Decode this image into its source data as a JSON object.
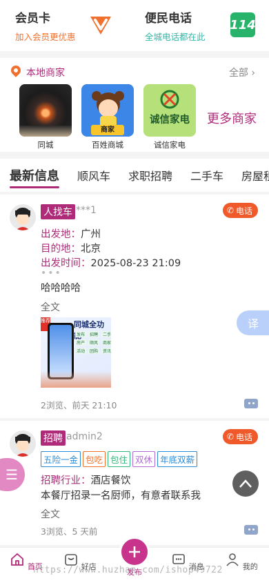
{
  "top_cards": [
    {
      "title": "会员卡",
      "subtitle": "加入会员更优惠",
      "subtitle_color": "#f0712d",
      "icon": "v-badge-icon"
    },
    {
      "title": "便民电话",
      "subtitle": "全城电话都在此",
      "subtitle_color": "#2fb8a8",
      "icon": "phone-114-icon",
      "icon_text": "114"
    }
  ],
  "local": {
    "title": "本地商家",
    "all_label": "全部",
    "merchants": [
      {
        "name": "同城",
        "thumb": "speaker-photo"
      },
      {
        "name": "百姓商城",
        "thumb": "cartoon-girl",
        "badge": "商家"
      },
      {
        "name": "诚信家电",
        "thumb": "chengxin-logo",
        "logo_text": "诚信家电"
      }
    ],
    "more_label": "更多商家"
  },
  "tabs": [
    "最新信息",
    "顺风车",
    "求职招聘",
    "二手车",
    "房屋租"
  ],
  "posts": [
    {
      "tag": "人找车",
      "author": "***1",
      "phone_label": "电话",
      "fields": [
        {
          "key": "出发地：",
          "value": "广州"
        },
        {
          "key": "目的地：",
          "value": "北京"
        },
        {
          "key": "出发时间：",
          "value": "2025-08-23 21:09"
        }
      ],
      "dots": "•••",
      "body": "哈哈哈哈",
      "fulltext_label": "全文",
      "image": {
        "corner": "推荐",
        "headline": "同城全功能",
        "items": [
          "发布",
          "招聘",
          "二手",
          "房产",
          "顺风",
          "商家",
          "活动",
          "团购",
          "资讯"
        ]
      },
      "meta": "2浏览、前天 21:10"
    },
    {
      "tag": "招聘",
      "author": "admin2",
      "phone_label": "电话",
      "chips": [
        {
          "text": "五险一金",
          "color": "#2a8bd6"
        },
        {
          "text": "包吃",
          "color": "#f0712d"
        },
        {
          "text": "包住",
          "color": "#2fb87a"
        },
        {
          "text": "双休",
          "color": "#b06ad6"
        },
        {
          "text": "年底双薪",
          "color": "#2a8bd6"
        }
      ],
      "field": {
        "key": "招聘行业：",
        "value": "酒店餐饮"
      },
      "body": "本餐厅招录一名厨师，有意者联系我",
      "fulltext_label": "全文",
      "meta": "3浏览、5 天前"
    }
  ],
  "floating": {
    "translate_label": "译",
    "menu_label": "☰"
  },
  "bottom_nav": [
    {
      "label": "首页",
      "icon": "home-icon",
      "active": true
    },
    {
      "label": "好店",
      "icon": "shop-icon"
    },
    {
      "label": "发布",
      "icon": "plus-icon",
      "publish": true
    },
    {
      "label": "消息",
      "icon": "message-icon"
    },
    {
      "label": "我的",
      "icon": "user-icon"
    }
  ],
  "watermark": "https://www.huzhan.com/ishop49722"
}
